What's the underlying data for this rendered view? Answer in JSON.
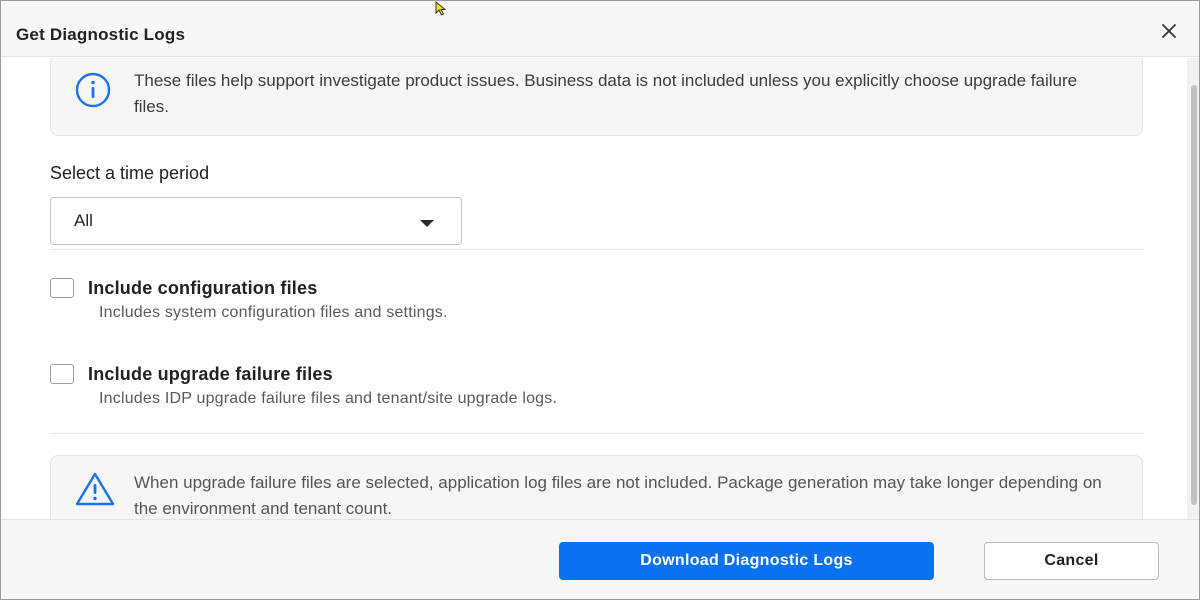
{
  "dialog": {
    "title": "Get Diagnostic Logs",
    "close_icon": "close-icon"
  },
  "info": {
    "icon": "info-icon",
    "text": "These files help support investigate product issues. Business data is not included unless you explicitly choose upgrade failure files."
  },
  "time_period": {
    "label": "Select a time period",
    "selected": "All",
    "caret_icon": "caret-down-icon"
  },
  "options": [
    {
      "title": "Include configuration files",
      "description": "Includes system configuration files and settings.",
      "checked": false
    },
    {
      "title": "Include upgrade failure files",
      "description": "Includes IDP upgrade failure files and tenant/site upgrade logs.",
      "checked": false
    }
  ],
  "warning": {
    "icon": "warning-icon",
    "text": "When upgrade failure files are selected, application log files are not included. Package generation may take longer depending on the environment and tenant count."
  },
  "footer": {
    "primary_label": "Download Diagnostic Logs",
    "secondary_label": "Cancel"
  },
  "colors": {
    "primary": "#0a72f0",
    "icon_blue": "#1a73e8"
  }
}
